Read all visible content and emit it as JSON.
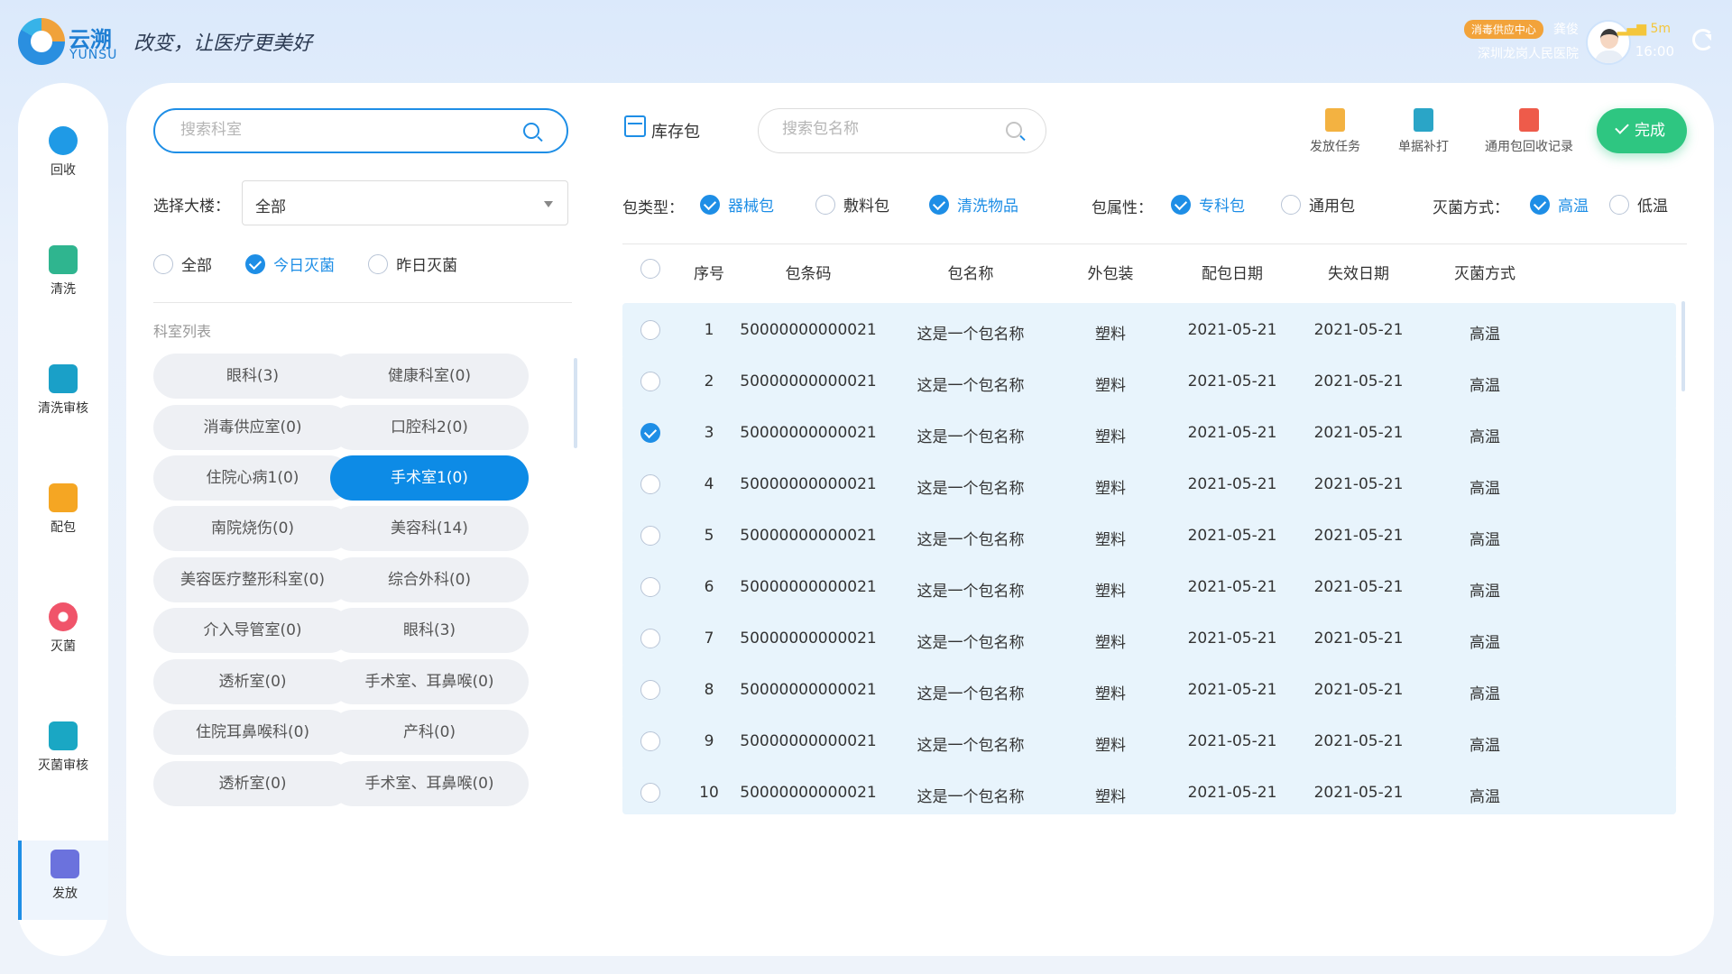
{
  "brand": {
    "name_cn": "云溯",
    "name_en": "YUNSU",
    "slogan": "改变，让医疗更美好"
  },
  "user": {
    "department": "消毒供应中心",
    "name": "龚俊",
    "hospital": "深圳龙岗人民医院",
    "signal": "5m",
    "time": "16:00"
  },
  "nav": [
    {
      "label": "回收",
      "icon": "recycle-icon"
    },
    {
      "label": "清洗",
      "icon": "wash-icon"
    },
    {
      "label": "清洗审核",
      "icon": "wash-review-icon"
    },
    {
      "label": "配包",
      "icon": "pack-icon"
    },
    {
      "label": "灭菌",
      "icon": "sterilize-icon"
    },
    {
      "label": "灭菌审核",
      "icon": "sterilize-review-icon"
    },
    {
      "label": "发放",
      "icon": "dispatch-icon",
      "active": true
    }
  ],
  "left_panel": {
    "search_placeholder": "搜索科室",
    "building_label": "选择大楼：",
    "building_value": "全部",
    "filters": [
      {
        "label": "全部",
        "checked": false
      },
      {
        "label": "今日灭菌",
        "checked": true
      },
      {
        "label": "昨日灭菌",
        "checked": false
      }
    ],
    "list_title": "科室列表",
    "departments": [
      {
        "label": "眼科(3)",
        "active": false
      },
      {
        "label": "健康科室(0)",
        "active": false
      },
      {
        "label": "消毒供应室(0)",
        "active": false
      },
      {
        "label": "口腔科2(0)",
        "active": false
      },
      {
        "label": "住院心病1(0)",
        "active": false
      },
      {
        "label": "手术室1(0)",
        "active": true
      },
      {
        "label": "南院烧伤(0)",
        "active": false
      },
      {
        "label": "美容科(14)",
        "active": false
      },
      {
        "label": "美容医疗整形科室(0)",
        "active": false
      },
      {
        "label": "综合外科(0)",
        "active": false
      },
      {
        "label": "介入导管室(0)",
        "active": false
      },
      {
        "label": "眼科(3)",
        "active": false
      },
      {
        "label": "透析室(0)",
        "active": false
      },
      {
        "label": "手术室、耳鼻喉(0)",
        "active": false
      },
      {
        "label": "住院耳鼻喉科(0)",
        "active": false
      },
      {
        "label": "产科(0)",
        "active": false
      },
      {
        "label": "透析室(0)",
        "active": false
      },
      {
        "label": "手术室、耳鼻喉(0)",
        "active": false
      }
    ]
  },
  "toolbar": {
    "stock_label": "库存包",
    "pkg_search_placeholder": "搜索包名称",
    "tools": [
      {
        "label": "发放任务",
        "icon": "dispatch-task-icon"
      },
      {
        "label": "单据补打",
        "icon": "print-icon"
      },
      {
        "label": "通用包回收记录",
        "icon": "recycle-record-icon"
      }
    ],
    "done_label": "完成"
  },
  "pkg_filters": {
    "type_label": "包类型：",
    "types": [
      {
        "label": "器械包",
        "checked": true
      },
      {
        "label": "敷料包",
        "checked": false
      },
      {
        "label": "清洗物品",
        "checked": true
      }
    ],
    "attr_label": "包属性：",
    "attrs": [
      {
        "label": "专科包",
        "checked": true
      },
      {
        "label": "通用包",
        "checked": false
      }
    ],
    "method_label": "灭菌方式：",
    "methods": [
      {
        "label": "高温",
        "checked": true
      },
      {
        "label": "低温",
        "checked": false
      }
    ]
  },
  "table": {
    "columns": [
      "序号",
      "包条码",
      "包名称",
      "外包装",
      "配包日期",
      "失效日期",
      "灭菌方式"
    ],
    "rows": [
      {
        "checked": false,
        "no": "1",
        "barcode": "50000000000021",
        "name": "这是一个包名称",
        "wrap": "塑料",
        "pack_date": "2021-05-21",
        "expire_date": "2021-05-21",
        "method": "高温"
      },
      {
        "checked": false,
        "no": "2",
        "barcode": "50000000000021",
        "name": "这是一个包名称",
        "wrap": "塑料",
        "pack_date": "2021-05-21",
        "expire_date": "2021-05-21",
        "method": "高温"
      },
      {
        "checked": true,
        "no": "3",
        "barcode": "50000000000021",
        "name": "这是一个包名称",
        "wrap": "塑料",
        "pack_date": "2021-05-21",
        "expire_date": "2021-05-21",
        "method": "高温"
      },
      {
        "checked": false,
        "no": "4",
        "barcode": "50000000000021",
        "name": "这是一个包名称",
        "wrap": "塑料",
        "pack_date": "2021-05-21",
        "expire_date": "2021-05-21",
        "method": "高温"
      },
      {
        "checked": false,
        "no": "5",
        "barcode": "50000000000021",
        "name": "这是一个包名称",
        "wrap": "塑料",
        "pack_date": "2021-05-21",
        "expire_date": "2021-05-21",
        "method": "高温"
      },
      {
        "checked": false,
        "no": "6",
        "barcode": "50000000000021",
        "name": "这是一个包名称",
        "wrap": "塑料",
        "pack_date": "2021-05-21",
        "expire_date": "2021-05-21",
        "method": "高温"
      },
      {
        "checked": false,
        "no": "7",
        "barcode": "50000000000021",
        "name": "这是一个包名称",
        "wrap": "塑料",
        "pack_date": "2021-05-21",
        "expire_date": "2021-05-21",
        "method": "高温"
      },
      {
        "checked": false,
        "no": "8",
        "barcode": "50000000000021",
        "name": "这是一个包名称",
        "wrap": "塑料",
        "pack_date": "2021-05-21",
        "expire_date": "2021-05-21",
        "method": "高温"
      },
      {
        "checked": false,
        "no": "9",
        "barcode": "50000000000021",
        "name": "这是一个包名称",
        "wrap": "塑料",
        "pack_date": "2021-05-21",
        "expire_date": "2021-05-21",
        "method": "高温"
      },
      {
        "checked": false,
        "no": "10",
        "barcode": "50000000000021",
        "name": "这是一个包名称",
        "wrap": "塑料",
        "pack_date": "2021-05-21",
        "expire_date": "2021-05-21",
        "method": "高温"
      }
    ]
  },
  "colors": {
    "accent": "#1e8ee6",
    "done": "#2ec681",
    "row_bg": "#e8f4fc",
    "badge": "#f2a33a"
  }
}
